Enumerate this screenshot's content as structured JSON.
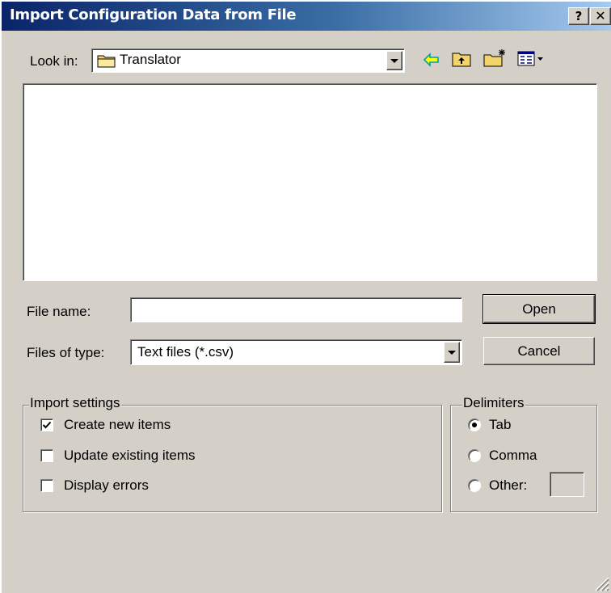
{
  "window": {
    "title": "Import Configuration Data from File",
    "help_label": "?",
    "close_label": "×"
  },
  "look_in": {
    "label": "Look in:",
    "value": "Translator",
    "icon": "folder-icon"
  },
  "toolbar": {
    "back_icon": "back-arrow-icon",
    "up_icon": "up-folder-icon",
    "new_folder_icon": "new-folder-icon",
    "view_menu_icon": "view-menu-icon"
  },
  "file_list": {
    "items": []
  },
  "file_name": {
    "label": "File name:",
    "value": ""
  },
  "file_type": {
    "label": "Files of type:",
    "value": "Text files (*.csv)"
  },
  "buttons": {
    "open": "Open",
    "cancel": "Cancel"
  },
  "import_settings": {
    "title": "Import settings",
    "options": [
      {
        "label": "Create new items",
        "checked": true
      },
      {
        "label": "Update existing items",
        "checked": false
      },
      {
        "label": "Display errors",
        "checked": false
      }
    ]
  },
  "delimiters": {
    "title": "Delimiters",
    "options": [
      {
        "label": "Tab",
        "selected": true
      },
      {
        "label": "Comma",
        "selected": false
      },
      {
        "label": "Other:",
        "selected": false
      }
    ],
    "other_value": ""
  },
  "colors": {
    "title_gradient_start": "#0a246a",
    "title_gradient_end": "#a6caf0",
    "face": "#d4d0c8"
  }
}
